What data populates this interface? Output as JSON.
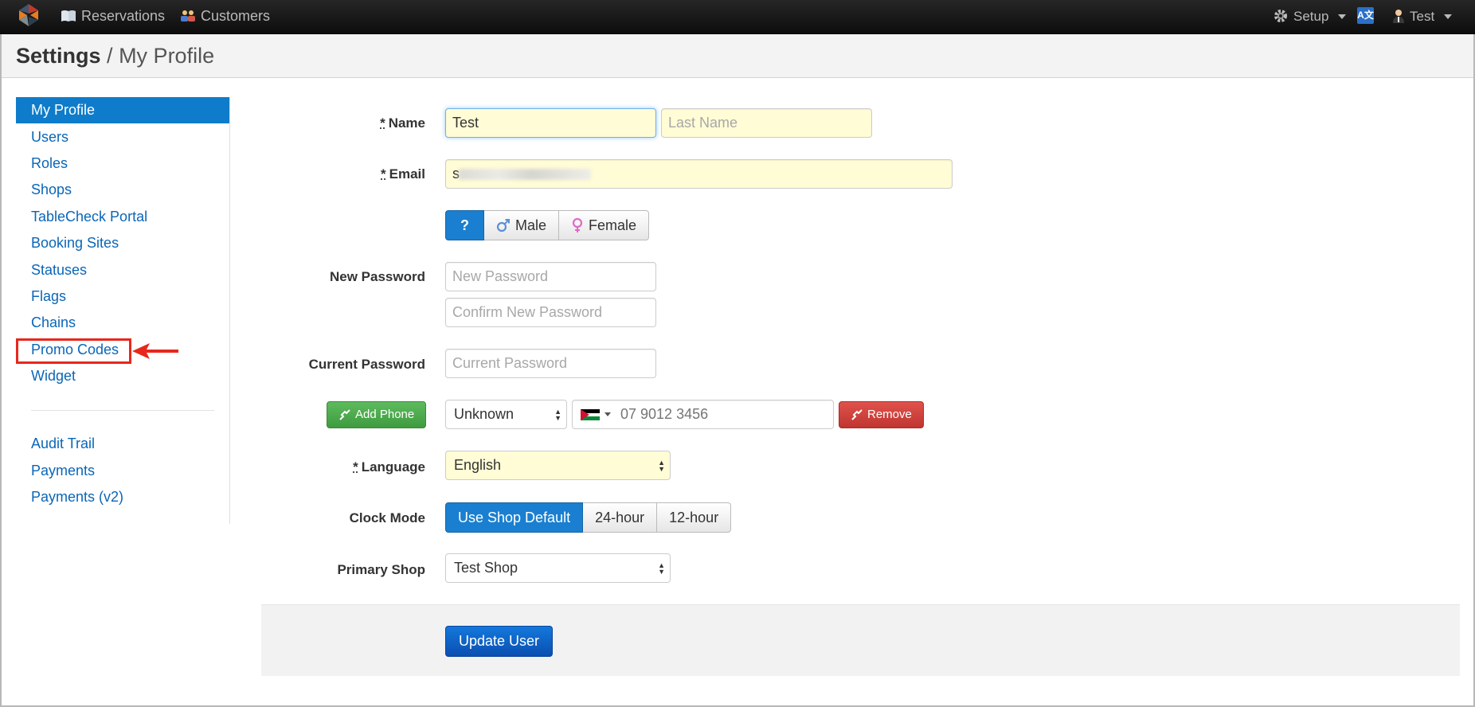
{
  "navbar": {
    "reservations": "Reservations",
    "customers": "Customers",
    "setup": "Setup",
    "user": "Test"
  },
  "header": {
    "section": "Settings",
    "separator": "/",
    "page": "My Profile"
  },
  "sidebar": {
    "items": [
      {
        "label": "My Profile"
      },
      {
        "label": "Users"
      },
      {
        "label": "Roles"
      },
      {
        "label": "Shops"
      },
      {
        "label": "TableCheck Portal"
      },
      {
        "label": "Booking Sites"
      },
      {
        "label": "Statuses"
      },
      {
        "label": "Flags"
      },
      {
        "label": "Chains"
      },
      {
        "label": "Promo Codes"
      },
      {
        "label": "Widget"
      }
    ],
    "secondary": [
      {
        "label": "Audit Trail"
      },
      {
        "label": "Payments"
      },
      {
        "label": "Payments (v2)"
      }
    ]
  },
  "form": {
    "required_mark": "*",
    "name_label": "Name",
    "first_name_value": "Test",
    "last_name_placeholder": "Last Name",
    "email_label": "Email",
    "email_value": "s",
    "gender": {
      "unknown": "?",
      "male": "Male",
      "female": "Female"
    },
    "new_password_label": "New Password",
    "new_password_placeholder": "New Password",
    "confirm_password_placeholder": "Confirm New Password",
    "current_password_label": "Current Password",
    "current_password_placeholder": "Current Password",
    "add_phone": "Add Phone",
    "phone_type": "Unknown",
    "phone_placeholder": "07 9012 3456",
    "remove": "Remove",
    "language_label": "Language",
    "language_value": "English",
    "clock_mode_label": "Clock Mode",
    "clock_modes": [
      "Use Shop Default",
      "24-hour",
      "12-hour"
    ],
    "primary_shop_label": "Primary Shop",
    "primary_shop_value": "Test Shop",
    "update_button": "Update User"
  },
  "colors": {
    "accent": "#0e7cca",
    "highlight": "#e8271c"
  },
  "icons": [
    "app-logo-icon",
    "book-icon",
    "customers-icon",
    "gear-icon",
    "translate-icon",
    "user-icon",
    "male-icon",
    "female-icon",
    "phone-icon",
    "flag-icon"
  ]
}
